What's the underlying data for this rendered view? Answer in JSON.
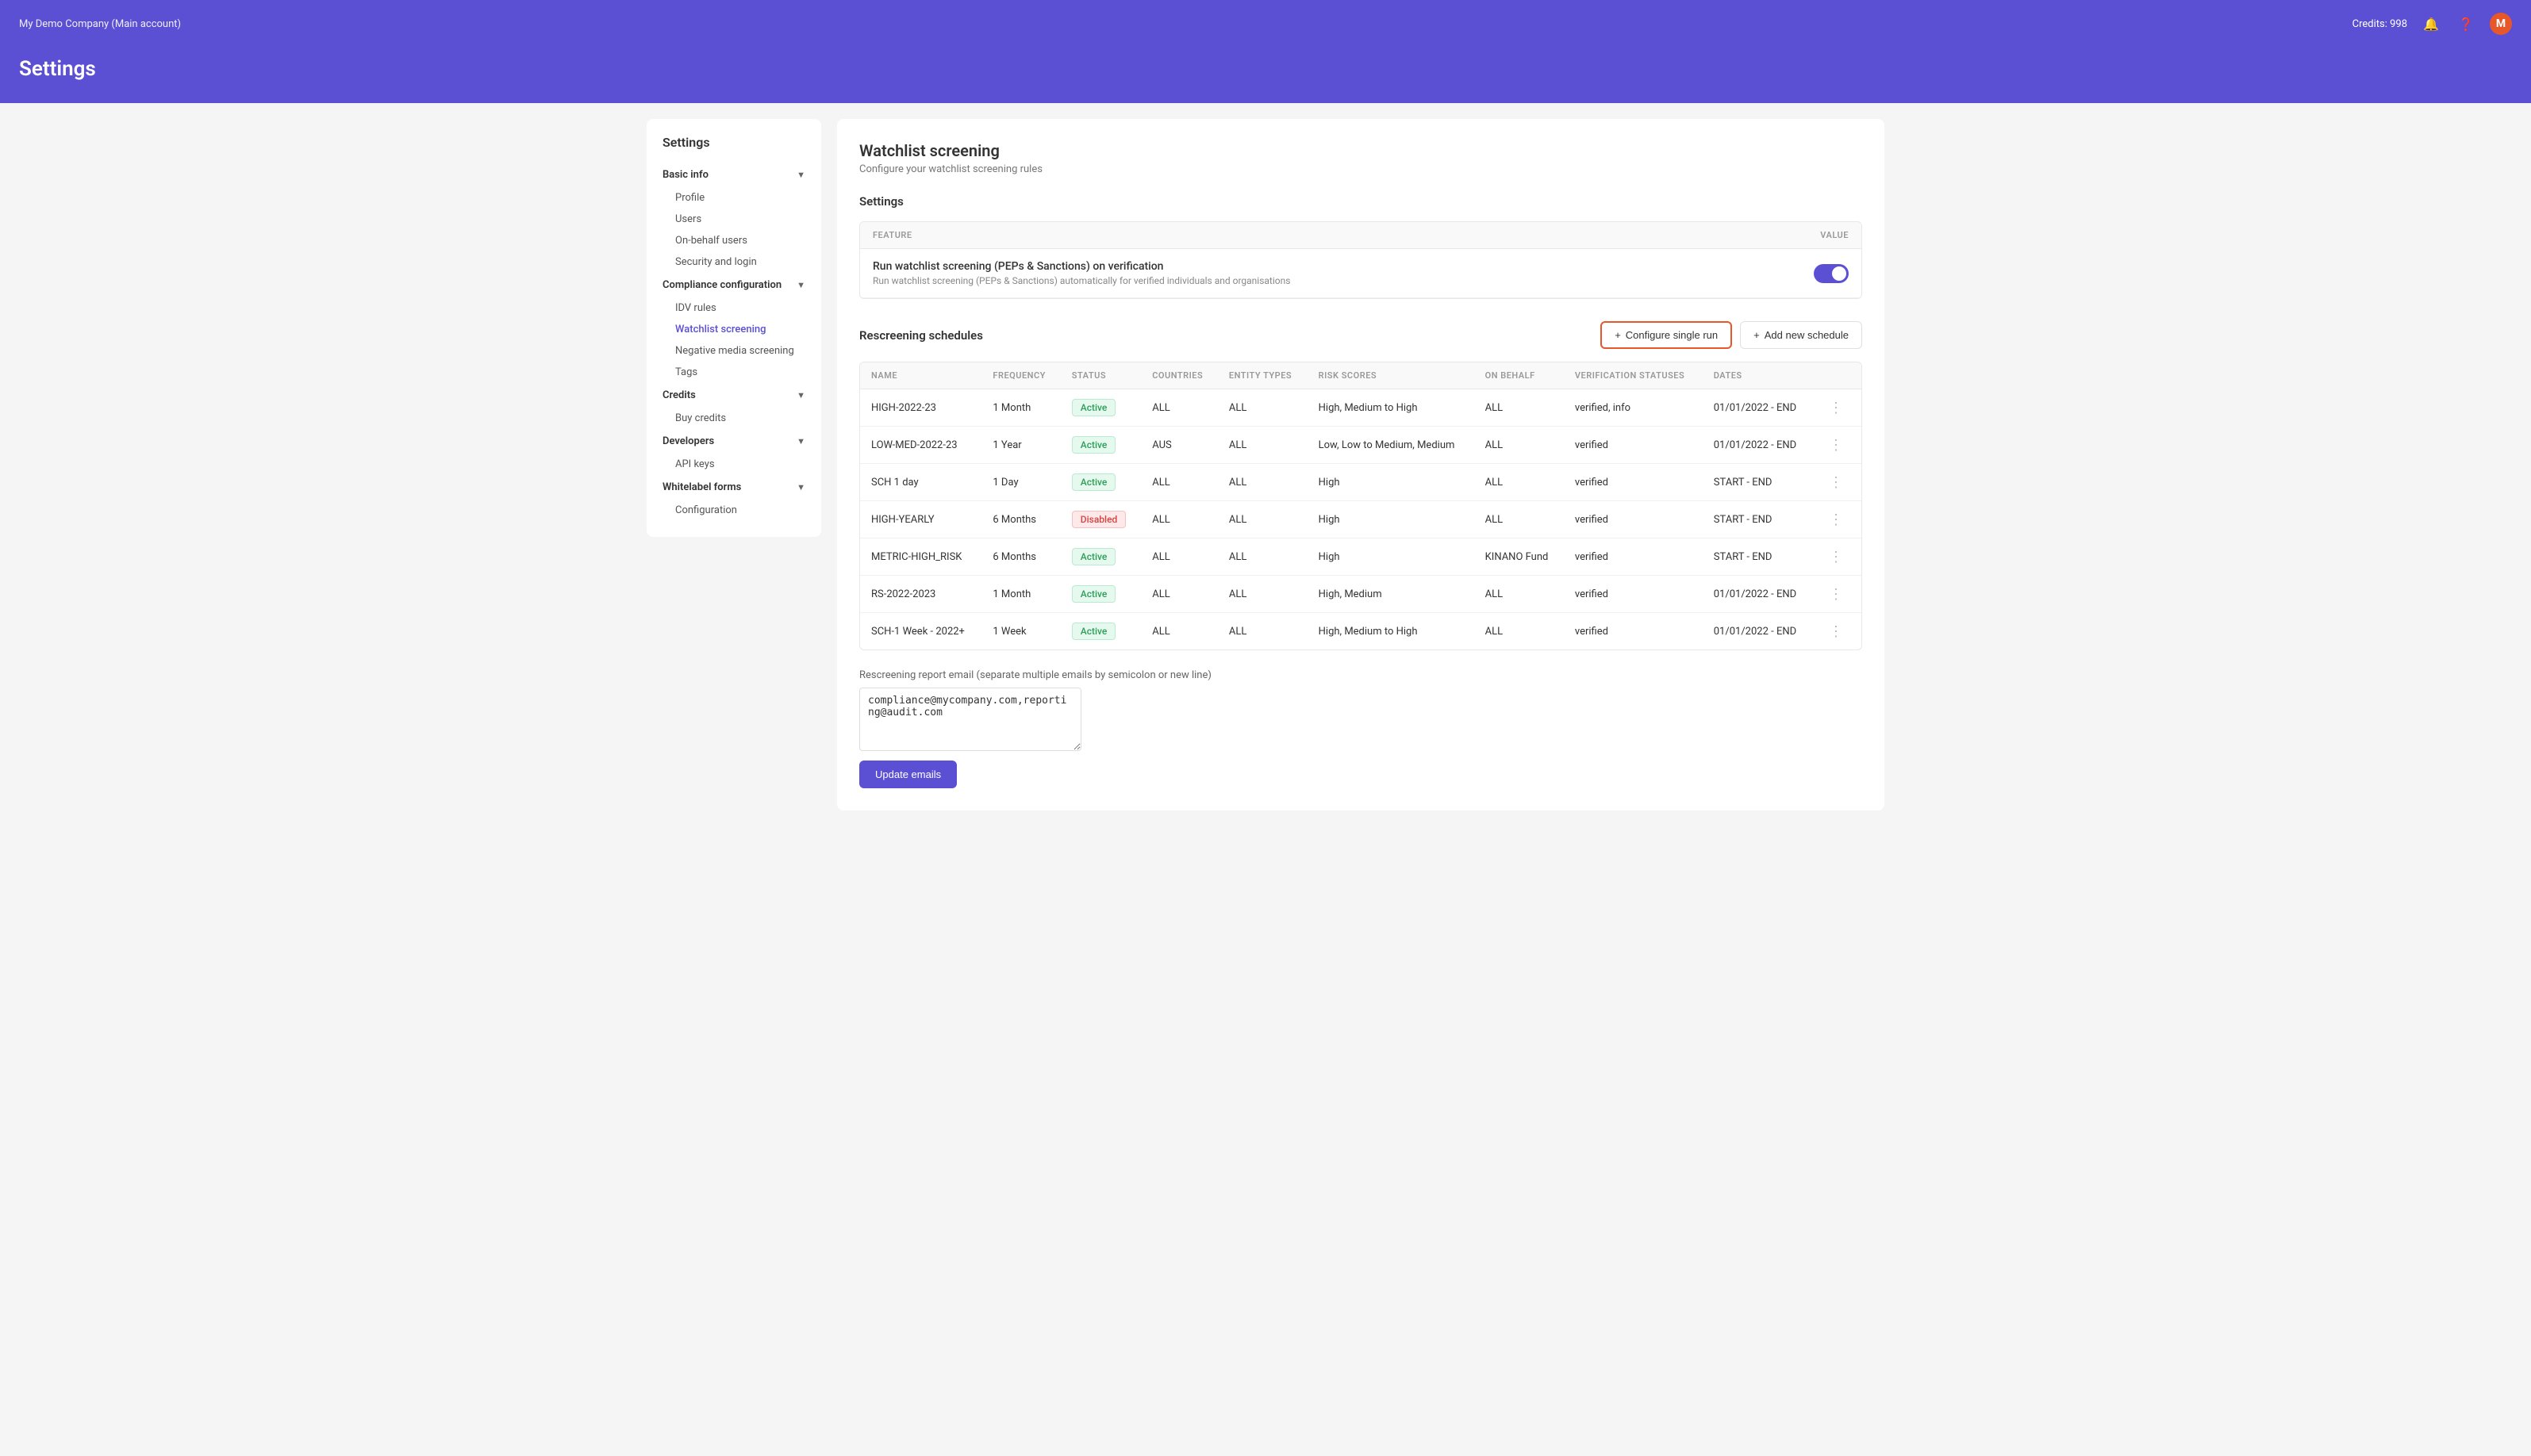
{
  "topNav": {
    "company": "My Demo Company (Main account)",
    "credits": "Credits: 998",
    "bell_icon": "bell",
    "help_icon": "question-circle",
    "avatar_label": "M"
  },
  "pageHeader": {
    "title": "Settings"
  },
  "sidebar": {
    "title": "Settings",
    "sections": [
      {
        "name": "Basic info",
        "id": "basic-info",
        "items": [
          "Profile",
          "Users",
          "On-behalf users",
          "Security and login"
        ]
      },
      {
        "name": "Compliance configuration",
        "id": "compliance-configuration",
        "items": [
          "IDV rules",
          "Watchlist screening",
          "Negative media screening",
          "Tags"
        ]
      },
      {
        "name": "Credits",
        "id": "credits",
        "items": [
          "Buy credits"
        ]
      },
      {
        "name": "Developers",
        "id": "developers",
        "items": [
          "API keys"
        ]
      },
      {
        "name": "Whitelabel forms",
        "id": "whitelabel-forms",
        "items": [
          "Configuration"
        ]
      }
    ]
  },
  "content": {
    "title": "Watchlist screening",
    "subtitle": "Configure your watchlist screening rules",
    "settings_label": "Settings",
    "feature_col": "FEATURE",
    "value_col": "VALUE",
    "feature_name": "Run watchlist screening (PEPs & Sanctions) on verification",
    "feature_desc": "Run watchlist screening (PEPs & Sanctions) automatically for verified individuals and organisations",
    "toggle_state": "on",
    "rescreening_title": "Rescreening schedules",
    "btn_configure": "Configure single run",
    "btn_add_schedule": "Add new schedule",
    "table_columns": [
      "NAME",
      "FREQUENCY",
      "STATUS",
      "COUNTRIES",
      "ENTITY TYPES",
      "RISK SCORES",
      "ON BEHALF",
      "VERIFICATION STATUSES",
      "DATES"
    ],
    "table_rows": [
      {
        "name": "HIGH-2022-23",
        "frequency": "1 Month",
        "status": "Active",
        "countries": "ALL",
        "entity_types": "ALL",
        "risk_scores": "High, Medium to High",
        "on_behalf": "ALL",
        "verification_statuses": "verified, info",
        "dates": "01/01/2022 - END"
      },
      {
        "name": "LOW-MED-2022-23",
        "frequency": "1 Year",
        "status": "Active",
        "countries": "AUS",
        "entity_types": "ALL",
        "risk_scores": "Low, Low to Medium, Medium",
        "on_behalf": "ALL",
        "verification_statuses": "verified",
        "dates": "01/01/2022 - END"
      },
      {
        "name": "SCH 1 day",
        "frequency": "1 Day",
        "status": "Active",
        "countries": "ALL",
        "entity_types": "ALL",
        "risk_scores": "High",
        "on_behalf": "ALL",
        "verification_statuses": "verified",
        "dates": "START - END"
      },
      {
        "name": "HIGH-YEARLY",
        "frequency": "6 Months",
        "status": "Disabled",
        "countries": "ALL",
        "entity_types": "ALL",
        "risk_scores": "High",
        "on_behalf": "ALL",
        "verification_statuses": "verified",
        "dates": "START - END"
      },
      {
        "name": "METRIC-HIGH_RISK",
        "frequency": "6 Months",
        "status": "Active",
        "countries": "ALL",
        "entity_types": "ALL",
        "risk_scores": "High",
        "on_behalf": "KINANO Fund",
        "verification_statuses": "verified",
        "dates": "START - END"
      },
      {
        "name": "RS-2022-2023",
        "frequency": "1 Month",
        "status": "Active",
        "countries": "ALL",
        "entity_types": "ALL",
        "risk_scores": "High, Medium",
        "on_behalf": "ALL",
        "verification_statuses": "verified",
        "dates": "01/01/2022 - END"
      },
      {
        "name": "SCH-1 Week - 2022+",
        "frequency": "1 Week",
        "status": "Active",
        "countries": "ALL",
        "entity_types": "ALL",
        "risk_scores": "High, Medium to High",
        "on_behalf": "ALL",
        "verification_statuses": "verified",
        "dates": "01/01/2022 - END"
      }
    ],
    "email_label": "Rescreening report email (separate multiple emails by semicolon or new line)",
    "email_value": "compliance@mycompany.com,reporting@audit.com",
    "btn_update_label": "Update emails"
  }
}
